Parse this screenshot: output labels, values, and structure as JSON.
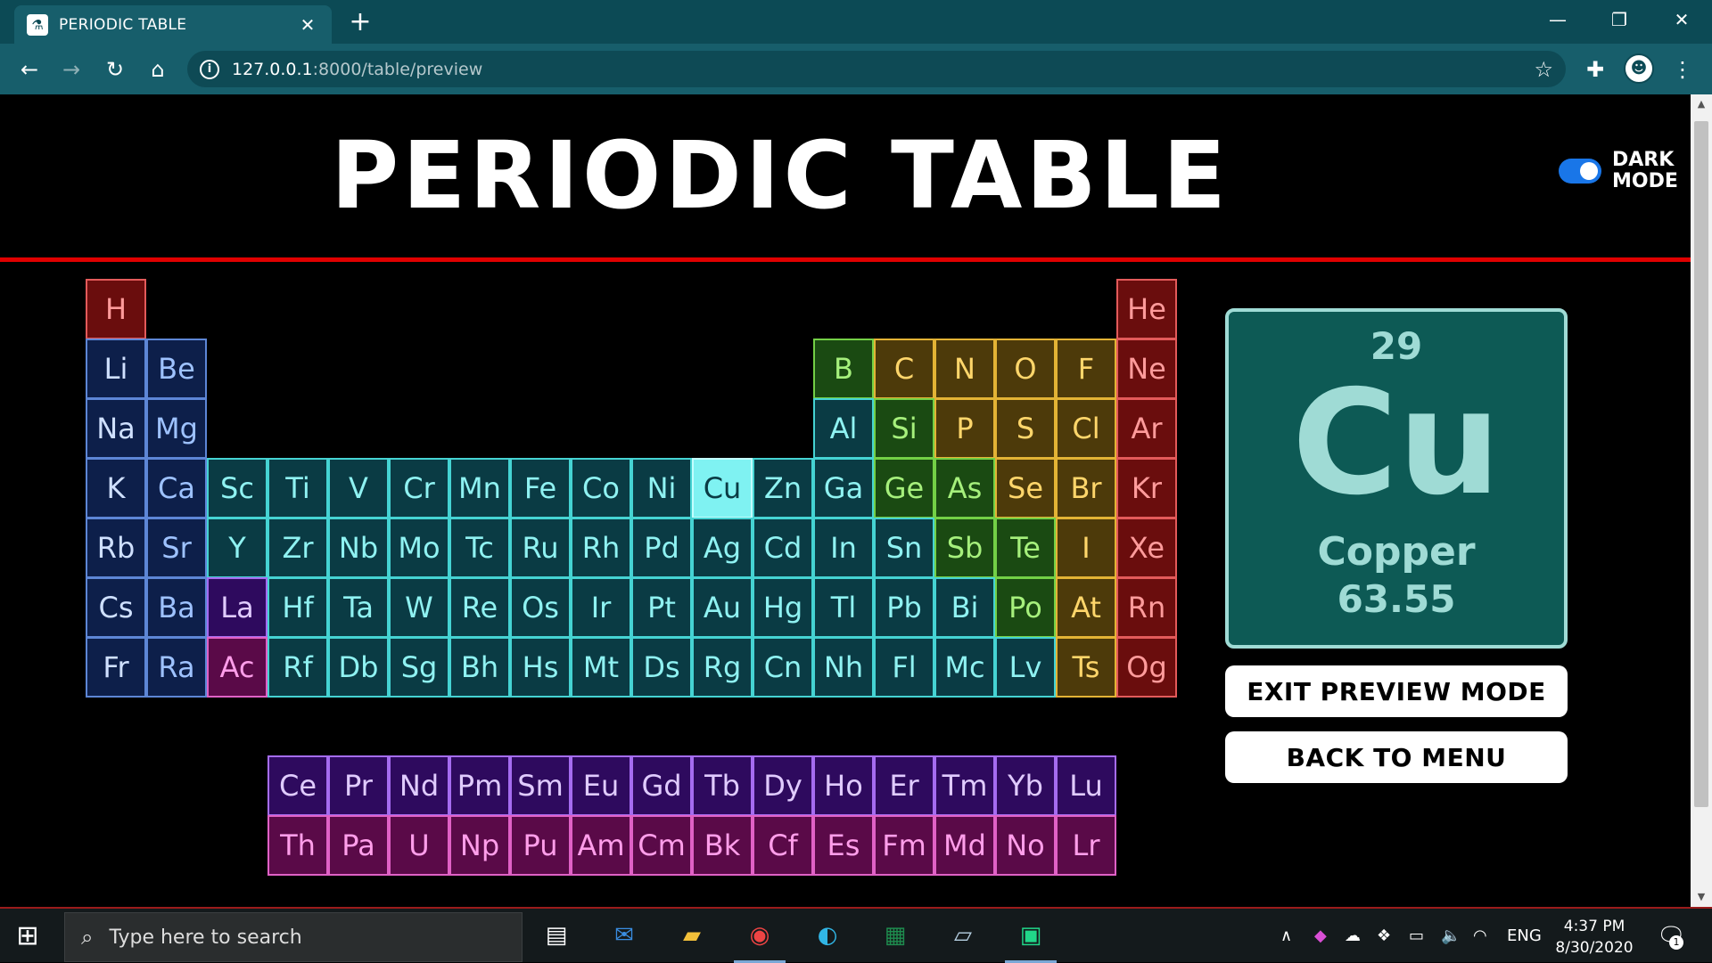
{
  "browser": {
    "tab_title": "PERIODIC TABLE",
    "tab_close": "✕",
    "new_tab": "+",
    "url_host": "127.0.0.1",
    "url_path": ":8000/table/preview",
    "window_controls": {
      "minimize": "—",
      "maximize": "❐",
      "close": "✕"
    }
  },
  "header": {
    "title": "PERIODIC TABLE",
    "toggle_label_line1": "DARK",
    "toggle_label_line2": "MODE",
    "dark_mode": true
  },
  "colors": {
    "accent_rule": "#e00000",
    "toggle": "#1976e8",
    "card_bg": "#0d5a55",
    "card_fg": "#9fdbd5"
  },
  "selected": {
    "number": "29",
    "symbol": "Cu",
    "name": "Copper",
    "mass": "63.55"
  },
  "buttons": {
    "exit_preview": "EXIT PREVIEW MODE",
    "back_to_menu": "BACK TO MENU"
  },
  "categories": {
    "nonmetal_red": {
      "bg": "#6a0d0d",
      "border": "#e35a5a",
      "fg": "#ff9b9b"
    },
    "alkali": {
      "bg": "#0d1f4a",
      "border": "#5d86d6",
      "fg": "#cfe0ff"
    },
    "alkaline": {
      "bg": "#0d1f4a",
      "border": "#5d86d6",
      "fg": "#9ec2ff"
    },
    "transition": {
      "bg": "#0a3b44",
      "border": "#45d3d3",
      "fg": "#8ff2f2"
    },
    "lanthanide": {
      "bg": "#2e0a5e",
      "border": "#a56cf0",
      "fg": "#e0cbff"
    },
    "actinide": {
      "bg": "#5a0a48",
      "border": "#e061c6",
      "fg": "#ff9eea"
    },
    "metalloid": {
      "bg": "#1a4a12",
      "border": "#73d046",
      "fg": "#a6f07c"
    },
    "nonmetal_gold": {
      "bg": "#4d3a0a",
      "border": "#e3b335",
      "fg": "#ffd66b"
    },
    "selected": {
      "bg": "#7ff2f2",
      "border": "#c3ffff",
      "fg": "#0a3b44"
    }
  },
  "elements": [
    {
      "s": "H",
      "c": "nonmetal_red",
      "r": 1,
      "g": 1
    },
    {
      "s": "He",
      "c": "nonmetal_red",
      "r": 1,
      "g": 18
    },
    {
      "s": "Li",
      "c": "alkali",
      "r": 2,
      "g": 1
    },
    {
      "s": "Be",
      "c": "alkaline",
      "r": 2,
      "g": 2
    },
    {
      "s": "B",
      "c": "metalloid",
      "r": 2,
      "g": 13
    },
    {
      "s": "C",
      "c": "nonmetal_gold",
      "r": 2,
      "g": 14
    },
    {
      "s": "N",
      "c": "nonmetal_gold",
      "r": 2,
      "g": 15
    },
    {
      "s": "O",
      "c": "nonmetal_gold",
      "r": 2,
      "g": 16
    },
    {
      "s": "F",
      "c": "nonmetal_gold",
      "r": 2,
      "g": 17
    },
    {
      "s": "Ne",
      "c": "nonmetal_red",
      "r": 2,
      "g": 18
    },
    {
      "s": "Na",
      "c": "alkali",
      "r": 3,
      "g": 1
    },
    {
      "s": "Mg",
      "c": "alkaline",
      "r": 3,
      "g": 2
    },
    {
      "s": "Al",
      "c": "transition",
      "r": 3,
      "g": 13
    },
    {
      "s": "Si",
      "c": "metalloid",
      "r": 3,
      "g": 14
    },
    {
      "s": "P",
      "c": "nonmetal_gold",
      "r": 3,
      "g": 15
    },
    {
      "s": "S",
      "c": "nonmetal_gold",
      "r": 3,
      "g": 16
    },
    {
      "s": "Cl",
      "c": "nonmetal_gold",
      "r": 3,
      "g": 17
    },
    {
      "s": "Ar",
      "c": "nonmetal_red",
      "r": 3,
      "g": 18
    },
    {
      "s": "K",
      "c": "alkali",
      "r": 4,
      "g": 1
    },
    {
      "s": "Ca",
      "c": "alkaline",
      "r": 4,
      "g": 2
    },
    {
      "s": "Sc",
      "c": "transition",
      "r": 4,
      "g": 3
    },
    {
      "s": "Ti",
      "c": "transition",
      "r": 4,
      "g": 4
    },
    {
      "s": "V",
      "c": "transition",
      "r": 4,
      "g": 5
    },
    {
      "s": "Cr",
      "c": "transition",
      "r": 4,
      "g": 6
    },
    {
      "s": "Mn",
      "c": "transition",
      "r": 4,
      "g": 7
    },
    {
      "s": "Fe",
      "c": "transition",
      "r": 4,
      "g": 8
    },
    {
      "s": "Co",
      "c": "transition",
      "r": 4,
      "g": 9
    },
    {
      "s": "Ni",
      "c": "transition",
      "r": 4,
      "g": 10
    },
    {
      "s": "Cu",
      "c": "selected",
      "r": 4,
      "g": 11
    },
    {
      "s": "Zn",
      "c": "transition",
      "r": 4,
      "g": 12
    },
    {
      "s": "Ga",
      "c": "transition",
      "r": 4,
      "g": 13
    },
    {
      "s": "Ge",
      "c": "metalloid",
      "r": 4,
      "g": 14
    },
    {
      "s": "As",
      "c": "metalloid",
      "r": 4,
      "g": 15
    },
    {
      "s": "Se",
      "c": "nonmetal_gold",
      "r": 4,
      "g": 16
    },
    {
      "s": "Br",
      "c": "nonmetal_gold",
      "r": 4,
      "g": 17
    },
    {
      "s": "Kr",
      "c": "nonmetal_red",
      "r": 4,
      "g": 18
    },
    {
      "s": "Rb",
      "c": "alkali",
      "r": 5,
      "g": 1
    },
    {
      "s": "Sr",
      "c": "alkaline",
      "r": 5,
      "g": 2
    },
    {
      "s": "Y",
      "c": "transition",
      "r": 5,
      "g": 3
    },
    {
      "s": "Zr",
      "c": "transition",
      "r": 5,
      "g": 4
    },
    {
      "s": "Nb",
      "c": "transition",
      "r": 5,
      "g": 5
    },
    {
      "s": "Mo",
      "c": "transition",
      "r": 5,
      "g": 6
    },
    {
      "s": "Tc",
      "c": "transition",
      "r": 5,
      "g": 7
    },
    {
      "s": "Ru",
      "c": "transition",
      "r": 5,
      "g": 8
    },
    {
      "s": "Rh",
      "c": "transition",
      "r": 5,
      "g": 9
    },
    {
      "s": "Pd",
      "c": "transition",
      "r": 5,
      "g": 10
    },
    {
      "s": "Ag",
      "c": "transition",
      "r": 5,
      "g": 11
    },
    {
      "s": "Cd",
      "c": "transition",
      "r": 5,
      "g": 12
    },
    {
      "s": "In",
      "c": "transition",
      "r": 5,
      "g": 13
    },
    {
      "s": "Sn",
      "c": "transition",
      "r": 5,
      "g": 14
    },
    {
      "s": "Sb",
      "c": "metalloid",
      "r": 5,
      "g": 15
    },
    {
      "s": "Te",
      "c": "metalloid",
      "r": 5,
      "g": 16
    },
    {
      "s": "I",
      "c": "nonmetal_gold",
      "r": 5,
      "g": 17
    },
    {
      "s": "Xe",
      "c": "nonmetal_red",
      "r": 5,
      "g": 18
    },
    {
      "s": "Cs",
      "c": "alkali",
      "r": 6,
      "g": 1
    },
    {
      "s": "Ba",
      "c": "alkaline",
      "r": 6,
      "g": 2
    },
    {
      "s": "La",
      "c": "lanthanide",
      "r": 6,
      "g": 3
    },
    {
      "s": "Hf",
      "c": "transition",
      "r": 6,
      "g": 4
    },
    {
      "s": "Ta",
      "c": "transition",
      "r": 6,
      "g": 5
    },
    {
      "s": "W",
      "c": "transition",
      "r": 6,
      "g": 6
    },
    {
      "s": "Re",
      "c": "transition",
      "r": 6,
      "g": 7
    },
    {
      "s": "Os",
      "c": "transition",
      "r": 6,
      "g": 8
    },
    {
      "s": "Ir",
      "c": "transition",
      "r": 6,
      "g": 9
    },
    {
      "s": "Pt",
      "c": "transition",
      "r": 6,
      "g": 10
    },
    {
      "s": "Au",
      "c": "transition",
      "r": 6,
      "g": 11
    },
    {
      "s": "Hg",
      "c": "transition",
      "r": 6,
      "g": 12
    },
    {
      "s": "Tl",
      "c": "transition",
      "r": 6,
      "g": 13
    },
    {
      "s": "Pb",
      "c": "transition",
      "r": 6,
      "g": 14
    },
    {
      "s": "Bi",
      "c": "transition",
      "r": 6,
      "g": 15
    },
    {
      "s": "Po",
      "c": "metalloid",
      "r": 6,
      "g": 16
    },
    {
      "s": "At",
      "c": "nonmetal_gold",
      "r": 6,
      "g": 17
    },
    {
      "s": "Rn",
      "c": "nonmetal_red",
      "r": 6,
      "g": 18
    },
    {
      "s": "Fr",
      "c": "alkali",
      "r": 7,
      "g": 1
    },
    {
      "s": "Ra",
      "c": "alkaline",
      "r": 7,
      "g": 2
    },
    {
      "s": "Ac",
      "c": "actinide",
      "r": 7,
      "g": 3
    },
    {
      "s": "Rf",
      "c": "transition",
      "r": 7,
      "g": 4
    },
    {
      "s": "Db",
      "c": "transition",
      "r": 7,
      "g": 5
    },
    {
      "s": "Sg",
      "c": "transition",
      "r": 7,
      "g": 6
    },
    {
      "s": "Bh",
      "c": "transition",
      "r": 7,
      "g": 7
    },
    {
      "s": "Hs",
      "c": "transition",
      "r": 7,
      "g": 8
    },
    {
      "s": "Mt",
      "c": "transition",
      "r": 7,
      "g": 9
    },
    {
      "s": "Ds",
      "c": "transition",
      "r": 7,
      "g": 10
    },
    {
      "s": "Rg",
      "c": "transition",
      "r": 7,
      "g": 11
    },
    {
      "s": "Cn",
      "c": "transition",
      "r": 7,
      "g": 12
    },
    {
      "s": "Nh",
      "c": "transition",
      "r": 7,
      "g": 13
    },
    {
      "s": "Fl",
      "c": "transition",
      "r": 7,
      "g": 14
    },
    {
      "s": "Mc",
      "c": "transition",
      "r": 7,
      "g": 15
    },
    {
      "s": "Lv",
      "c": "transition",
      "r": 7,
      "g": 16
    },
    {
      "s": "Ts",
      "c": "nonmetal_gold",
      "r": 7,
      "g": 17
    },
    {
      "s": "Og",
      "c": "nonmetal_red",
      "r": 7,
      "g": 18
    },
    {
      "s": "Ce",
      "c": "lanthanide",
      "r": 9,
      "g": 4
    },
    {
      "s": "Pr",
      "c": "lanthanide",
      "r": 9,
      "g": 5
    },
    {
      "s": "Nd",
      "c": "lanthanide",
      "r": 9,
      "g": 6
    },
    {
      "s": "Pm",
      "c": "lanthanide",
      "r": 9,
      "g": 7
    },
    {
      "s": "Sm",
      "c": "lanthanide",
      "r": 9,
      "g": 8
    },
    {
      "s": "Eu",
      "c": "lanthanide",
      "r": 9,
      "g": 9
    },
    {
      "s": "Gd",
      "c": "lanthanide",
      "r": 9,
      "g": 10
    },
    {
      "s": "Tb",
      "c": "lanthanide",
      "r": 9,
      "g": 11
    },
    {
      "s": "Dy",
      "c": "lanthanide",
      "r": 9,
      "g": 12
    },
    {
      "s": "Ho",
      "c": "lanthanide",
      "r": 9,
      "g": 13
    },
    {
      "s": "Er",
      "c": "lanthanide",
      "r": 9,
      "g": 14
    },
    {
      "s": "Tm",
      "c": "lanthanide",
      "r": 9,
      "g": 15
    },
    {
      "s": "Yb",
      "c": "lanthanide",
      "r": 9,
      "g": 16
    },
    {
      "s": "Lu",
      "c": "lanthanide",
      "r": 9,
      "g": 17
    },
    {
      "s": "Th",
      "c": "actinide",
      "r": 10,
      "g": 4
    },
    {
      "s": "Pa",
      "c": "actinide",
      "r": 10,
      "g": 5
    },
    {
      "s": "U",
      "c": "actinide",
      "r": 10,
      "g": 6
    },
    {
      "s": "Np",
      "c": "actinide",
      "r": 10,
      "g": 7
    },
    {
      "s": "Pu",
      "c": "actinide",
      "r": 10,
      "g": 8
    },
    {
      "s": "Am",
      "c": "actinide",
      "r": 10,
      "g": 9
    },
    {
      "s": "Cm",
      "c": "actinide",
      "r": 10,
      "g": 10
    },
    {
      "s": "Bk",
      "c": "actinide",
      "r": 10,
      "g": 11
    },
    {
      "s": "Cf",
      "c": "actinide",
      "r": 10,
      "g": 12
    },
    {
      "s": "Es",
      "c": "actinide",
      "r": 10,
      "g": 13
    },
    {
      "s": "Fm",
      "c": "actinide",
      "r": 10,
      "g": 14
    },
    {
      "s": "Md",
      "c": "actinide",
      "r": 10,
      "g": 15
    },
    {
      "s": "No",
      "c": "actinide",
      "r": 10,
      "g": 16
    },
    {
      "s": "Lr",
      "c": "actinide",
      "r": 10,
      "g": 17
    }
  ],
  "taskbar": {
    "search_placeholder": "Type here to search",
    "language": "ENG",
    "time": "4:37 PM",
    "date": "8/30/2020",
    "notification_count": "1",
    "pinned": [
      "task-view-icon",
      "mail-icon",
      "file-explorer-icon",
      "chrome-icon",
      "edge-icon",
      "excel-icon",
      "notes-icon",
      "pycharm-icon"
    ]
  }
}
